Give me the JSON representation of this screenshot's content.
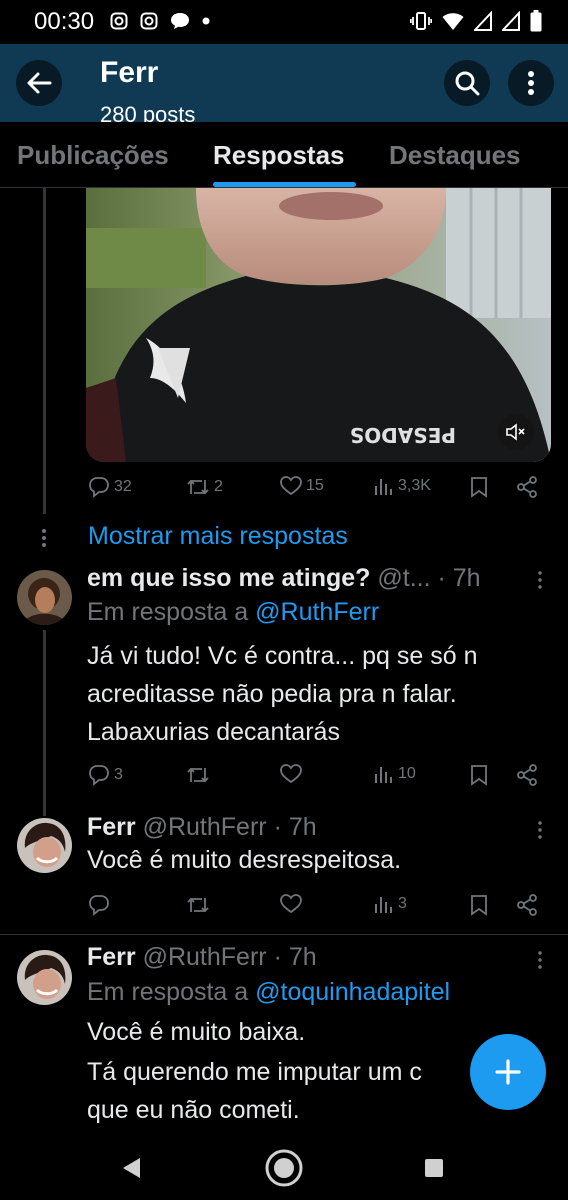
{
  "status": {
    "time": "00:30"
  },
  "header": {
    "title": "Ferr",
    "subtitle": "280 posts"
  },
  "tabs": [
    {
      "label": "Publicações",
      "active": false
    },
    {
      "label": "Respostas",
      "active": true
    },
    {
      "label": "Destaques",
      "active": false
    }
  ],
  "video_post": {
    "shirt_text": "PESADOS",
    "actions": {
      "replies": "32",
      "reposts": "2",
      "likes": "15",
      "views": "3,3K"
    }
  },
  "show_more": "Mostrar mais respostas",
  "replies": [
    {
      "name": "em que isso me atinge?",
      "handle": "@t...",
      "sep": "·",
      "time": "7h",
      "reply_label": "Em resposta a",
      "reply_to": "@RuthFerr",
      "lines": [
        "Já vi tudo! Vc é contra... pq se só n",
        "acreditasse não pedia pra n falar.",
        "Labaxurias decantarás"
      ],
      "actions": {
        "replies": "3",
        "reposts": "",
        "likes": "",
        "views": "10"
      }
    },
    {
      "name": "Ferr",
      "handle": "@RuthFerr",
      "sep": "·",
      "time": "7h",
      "lines": [
        "Você é muito desrespeitosa."
      ],
      "actions": {
        "replies": "",
        "reposts": "",
        "likes": "",
        "views": "3"
      }
    },
    {
      "name": "Ferr",
      "handle": "@RuthFerr",
      "sep": "·",
      "time": "7h",
      "reply_label": "Em resposta a",
      "reply_to": "@toquinhadapitel",
      "lines": [
        "Você é muito baixa.",
        "Tá querendo me imputar um c",
        "que eu não cometi."
      ]
    }
  ],
  "colors": {
    "accent": "#1d9bf0",
    "header_bg": "#103a54",
    "muted": "#71767b"
  }
}
